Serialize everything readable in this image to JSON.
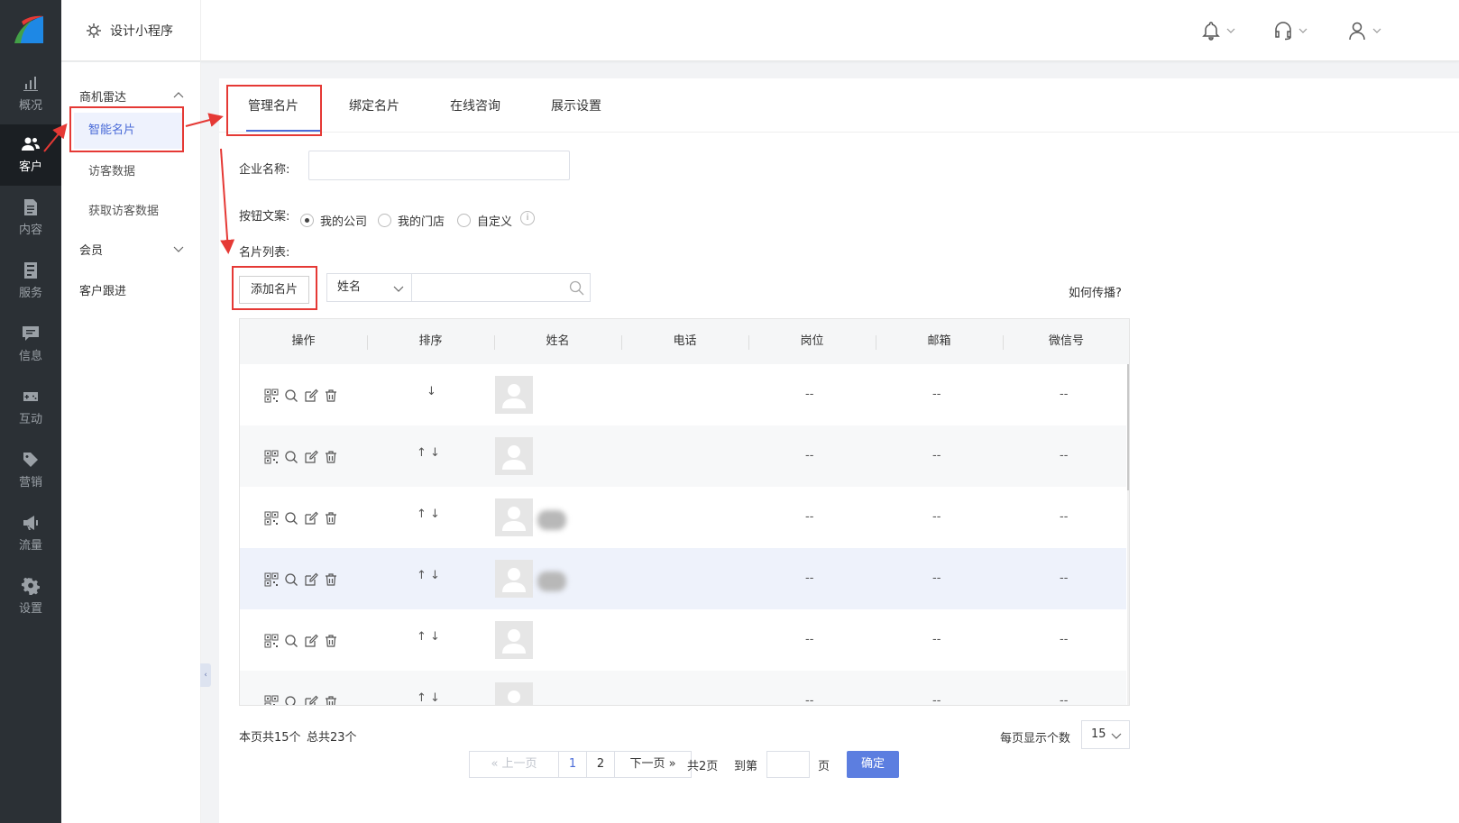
{
  "rail": {
    "items": [
      {
        "label": "概况",
        "icon": "chart-icon"
      },
      {
        "label": "客户",
        "icon": "users-icon"
      },
      {
        "label": "内容",
        "icon": "document-icon"
      },
      {
        "label": "服务",
        "icon": "service-icon"
      },
      {
        "label": "信息",
        "icon": "message-icon"
      },
      {
        "label": "互动",
        "icon": "gamepad-icon"
      },
      {
        "label": "营销",
        "icon": "tag-icon"
      },
      {
        "label": "流量",
        "icon": "megaphone-icon"
      },
      {
        "label": "设置",
        "icon": "gear-icon"
      }
    ],
    "active_index": 1
  },
  "header": {
    "design_label": "设计小程序"
  },
  "subnav": {
    "group1": "商机雷达",
    "items": [
      "智能名片",
      "访客数据",
      "获取访客数据"
    ],
    "group2": "会员",
    "group3": "客户跟进"
  },
  "tabs": [
    "管理名片",
    "绑定名片",
    "在线咨询",
    "展示设置"
  ],
  "form": {
    "company_label": "企业名称:",
    "button_text_label": "按钮文案:",
    "radios": [
      "我的公司",
      "我的门店",
      "自定义"
    ],
    "selected_radio": 0,
    "card_list_label": "名片列表:",
    "add_button": "添加名片",
    "search_field_select": "姓名",
    "how_link": "如何传播?"
  },
  "table": {
    "columns": [
      "操作",
      "排序",
      "姓名",
      "电话",
      "岗位",
      "邮箱",
      "微信号"
    ],
    "rows": [
      {
        "sort": "↓",
        "position": "--",
        "email": "--",
        "wechat": "--"
      },
      {
        "sort": "↑ ↓",
        "position": "--",
        "email": "--",
        "wechat": "--"
      },
      {
        "sort": "↑ ↓",
        "position": "--",
        "email": "--",
        "wechat": "--"
      },
      {
        "sort": "↑ ↓",
        "position": "--",
        "email": "--",
        "wechat": "--"
      },
      {
        "sort": "↑ ↓",
        "position": "--",
        "email": "--",
        "wechat": "--"
      },
      {
        "sort": "↑ ↓",
        "position": "--",
        "email": "--",
        "wechat": "--"
      }
    ]
  },
  "footer": {
    "page_count_text": "本页共15个",
    "total_text": "总共23个",
    "per_page_label": "每页显示个数",
    "per_page_value": "15",
    "prev": "上一页",
    "pages": [
      "1",
      "2"
    ],
    "next": "下一页",
    "total_pages": "共2页",
    "goto_label": "到第",
    "page_unit": "页",
    "confirm": "确定"
  },
  "colors": {
    "accent": "#4a6bd8",
    "highlight": "#e53935",
    "rail_bg": "#2b3035"
  }
}
